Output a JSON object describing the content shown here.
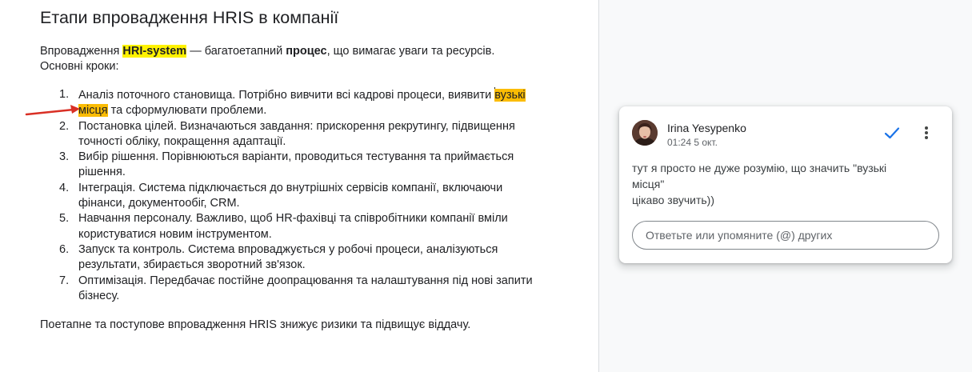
{
  "document": {
    "title": "Етапи впровадження HRIS в компанії",
    "intro": {
      "part1": "Впровадження ",
      "highlight": "HRI-system",
      "part2": " — багатоетапний ",
      "bold": "процес",
      "part3": ", що вимагає уваги та ресурсів.",
      "line2": "Основні кроки:"
    },
    "steps": [
      {
        "num": "1.",
        "pre": "Аналіз поточного становища. Потрібно вивчити всі кадрові процеси, виявити ",
        "highlight": "вузькі місця",
        "post": " та сформулювати проблеми."
      },
      {
        "num": "2.",
        "text": "Постановка цілей. Визначаються завдання: прискорення рекрутингу, підвищення точності обліку, покращення адаптації."
      },
      {
        "num": "3.",
        "text": "Вибір рішення. Порівнюються варіанти, проводиться тестування та приймається рішення."
      },
      {
        "num": "4.",
        "text": "Інтеграція. Система підключається до внутрішніх сервісів компанії, включаючи фінанси, документообіг, CRM."
      },
      {
        "num": "5.",
        "text": "Навчання персоналу. Важливо, щоб HR-фахівці та співробітники компанії вміли користуватися новим інструментом."
      },
      {
        "num": "6.",
        "text": "Запуск та контроль. Система впроваджується у робочі процеси, аналізуються результати, збирається зворотний зв'язок."
      },
      {
        "num": "7.",
        "text": "Оптимізація. Передбачає постійне доопрацювання та налаштування під нові запити бізнесу."
      }
    ],
    "outro": "Поетапне та поступове впровадження HRIS знижує ризики та підвищує віддачу."
  },
  "comment": {
    "author": "Irina Yesypenko",
    "time": "01:24 5 окт.",
    "body_lines": [
      "тут я просто не дуже розумію, що значить \"вузькі",
      "місця\"",
      "цікаво звучить))"
    ],
    "reply_placeholder": "Ответьте или упомяните (@) других",
    "resolve_icon": "checkmark-icon",
    "more_icon": "more-vert-icon"
  },
  "colors": {
    "highlight_yellow": "#fff200",
    "highlight_orange": "#fbbc04",
    "arrow_red": "#d93025",
    "resolve_blue": "#1a73e8"
  }
}
